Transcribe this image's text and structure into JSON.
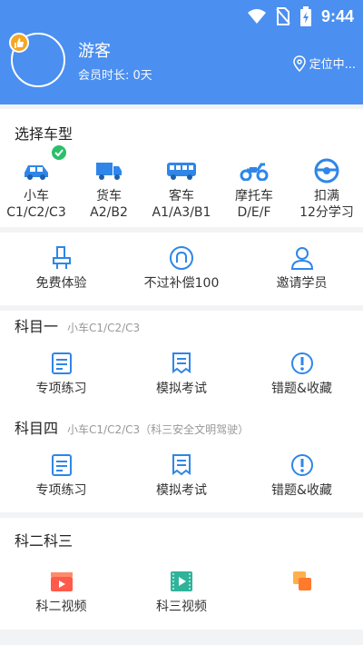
{
  "status_bar": {
    "time": "9:44"
  },
  "profile": {
    "name": "游客",
    "membership": "会员时长: 0天",
    "location": "定位中..."
  },
  "vehicle_section": {
    "title": "选择车型",
    "items": [
      {
        "name": "小车",
        "code": "C1/C2/C3",
        "icon": "car-icon",
        "selected": true
      },
      {
        "name": "货车",
        "code": "A2/B2",
        "icon": "truck-icon"
      },
      {
        "name": "客车",
        "code": "A1/A3/B1",
        "icon": "bus-icon"
      },
      {
        "name": "摩托车",
        "code": "D/E/F",
        "icon": "motorcycle-icon"
      },
      {
        "name": "扣满",
        "code": "12分学习",
        "icon": "steering-wheel-icon"
      }
    ]
  },
  "feature_section": {
    "items": [
      {
        "label": "免费体验",
        "icon": "seat-icon"
      },
      {
        "label": "不过补偿100",
        "icon": "shield-icon"
      },
      {
        "label": "邀请学员",
        "icon": "person-icon"
      }
    ]
  },
  "subject1": {
    "title": "科目一",
    "subtitle": "小车C1/C2/C3",
    "items": [
      {
        "label": "专项练习",
        "icon": "practice-icon"
      },
      {
        "label": "模拟考试",
        "icon": "exam-icon"
      },
      {
        "label": "错题&收藏",
        "icon": "exclamation-icon"
      }
    ]
  },
  "subject4": {
    "title": "科目四",
    "subtitle": "小车C1/C2/C3（科三安全文明驾驶）",
    "items": [
      {
        "label": "专项练习",
        "icon": "practice-icon"
      },
      {
        "label": "模拟考试",
        "icon": "exam-icon"
      },
      {
        "label": "错题&收藏",
        "icon": "exclamation-icon"
      }
    ]
  },
  "subject23": {
    "title": "科二科三",
    "items": [
      {
        "label": "科二视频",
        "icon": "video-clapper-icon"
      },
      {
        "label": "科三视频",
        "icon": "film-icon"
      },
      {
        "label": "",
        "icon": "squares-icon"
      }
    ]
  },
  "colors": {
    "header": "#4b8ff0",
    "accent": "#2f86e8",
    "check": "#2bbf6a"
  }
}
